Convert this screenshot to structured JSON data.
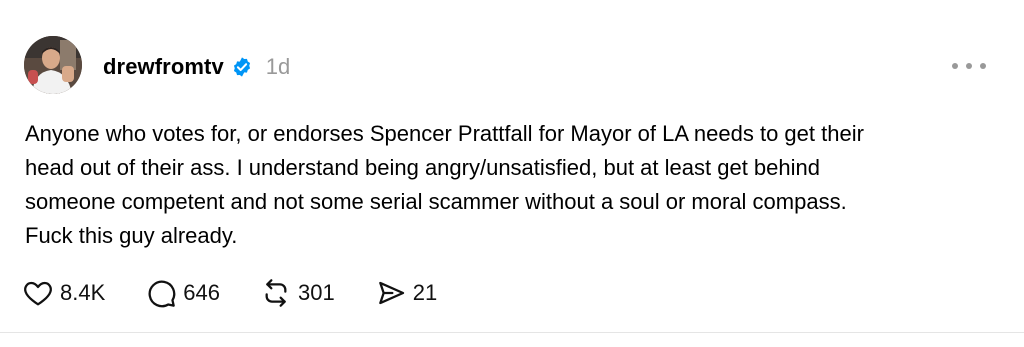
{
  "post": {
    "username": "drewfromtv",
    "verified": true,
    "timestamp": "1d",
    "text": "Anyone who votes for, or endorses Spencer Prattfall for Mayor of LA needs to get their\nhead out of their ass. I understand being angry/unsatisfied, but at least get behind\nsomeone competent and not some serial scammer without a soul or moral compass.\nFuck this guy already.",
    "icons": {
      "avatar": "avatar",
      "verified": "verified-badge-icon",
      "more": "more-options-icon",
      "like": "heart-icon",
      "reply": "comment-bubble-icon",
      "repost": "repost-arrows-icon",
      "share": "send-arrow-icon"
    },
    "actions": {
      "likes": "8.4K",
      "replies": "646",
      "reposts": "301",
      "shares": "21"
    }
  },
  "colors": {
    "verified_blue": "#0095f6",
    "timestamp_gray": "#999999",
    "text": "#000000"
  }
}
